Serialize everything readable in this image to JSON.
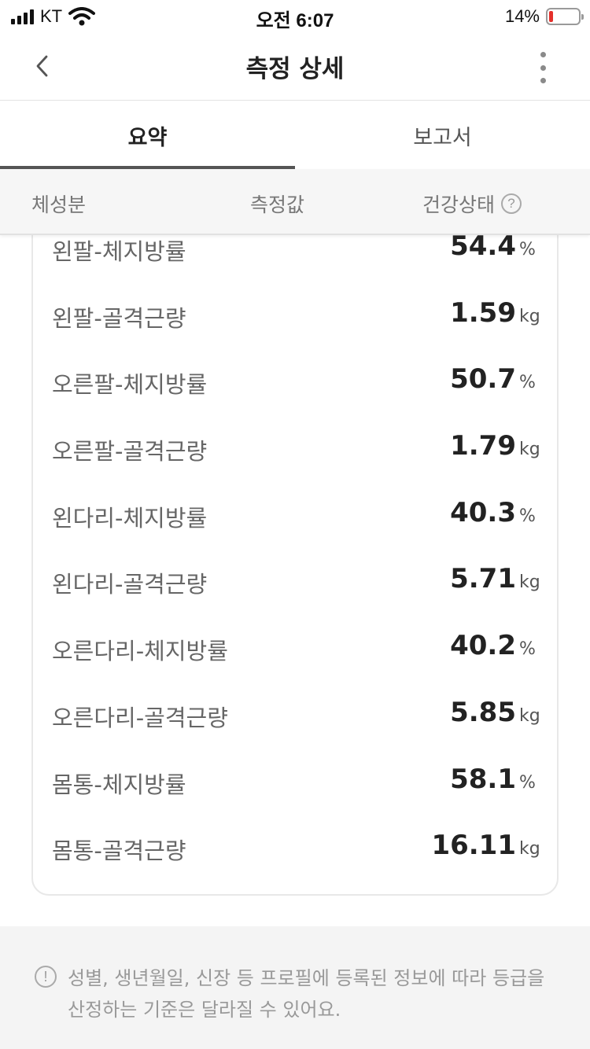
{
  "status_bar": {
    "carrier": "KT",
    "time": "오전 6:07",
    "battery_percent": "14%",
    "battery_level": 0.14,
    "battery_color": "#e5302b"
  },
  "header": {
    "back_icon": "chevron-left-icon",
    "title": "측정 상세",
    "more_icon": "more-vertical-icon"
  },
  "tabs": [
    {
      "label": "요약",
      "active": true
    },
    {
      "label": "보고서",
      "active": false
    }
  ],
  "columns": {
    "composition": "체성분",
    "value": "측정값",
    "health_status": "건강상태",
    "help_icon": "question-circle-icon"
  },
  "rows": [
    {
      "label": "왼팔-체지방률",
      "value": "54.4",
      "unit": "%"
    },
    {
      "label": "왼팔-골격근량",
      "value": "1.59",
      "unit": "kg"
    },
    {
      "label": "오른팔-체지방률",
      "value": "50.7",
      "unit": "%"
    },
    {
      "label": "오른팔-골격근량",
      "value": "1.79",
      "unit": "kg"
    },
    {
      "label": "왼다리-체지방률",
      "value": "40.3",
      "unit": "%"
    },
    {
      "label": "왼다리-골격근량",
      "value": "5.71",
      "unit": "kg"
    },
    {
      "label": "오른다리-체지방률",
      "value": "40.2",
      "unit": "%"
    },
    {
      "label": "오른다리-골격근량",
      "value": "5.85",
      "unit": "kg"
    },
    {
      "label": "몸통-체지방률",
      "value": "58.1",
      "unit": "%"
    },
    {
      "label": "몸통-골격근량",
      "value": "16.11",
      "unit": "kg"
    }
  ],
  "note": {
    "icon": "info-circle-icon",
    "text": "성별, 생년월일, 신장 등 프로필에 등록된 정보에 따라 등급을 산정하는 기준은 달라질 수 있어요."
  }
}
